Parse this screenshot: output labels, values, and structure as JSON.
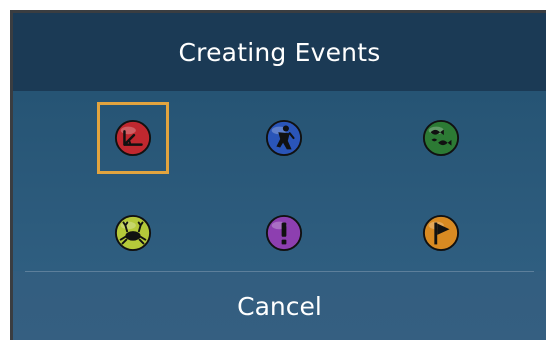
{
  "dialog": {
    "title": "Creating Events",
    "cancel_label": "Cancel"
  },
  "events": [
    {
      "icon": "measure-icon",
      "color": "#c0282f",
      "selected": true
    },
    {
      "icon": "diver-icon",
      "color": "#2a55b8",
      "selected": false
    },
    {
      "icon": "fish-school-icon",
      "color": "#2c7a34",
      "selected": false
    },
    {
      "icon": "crab-icon",
      "color": "#b5c93a",
      "selected": false
    },
    {
      "icon": "exclamation-icon",
      "color": "#8d3fb0",
      "selected": false
    },
    {
      "icon": "flag-icon",
      "color": "#d88a22",
      "selected": false
    }
  ],
  "colors": {
    "selection_border": "#e2a43f",
    "title_bar": "#1b3a55",
    "panel": "#2d5b7d"
  }
}
